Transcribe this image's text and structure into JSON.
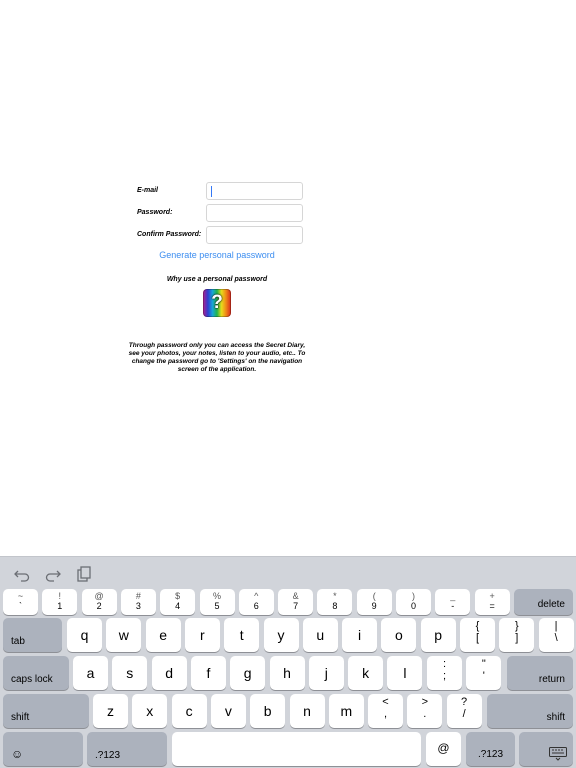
{
  "form": {
    "email_label": "E-mail",
    "password_label": "Password:",
    "confirm_label": "Confirm Password:",
    "email_value": "",
    "password_value": "",
    "confirm_value": "",
    "generate_link": "Generate personal password",
    "why_label": "Why use a personal password",
    "help_icon_glyph": "?",
    "description": "Through password only you can access the Secret Diary, see your photos, your notes, listen to your audio, etc.. To change the password go to 'Settings' on the navigation screen of the application."
  },
  "keyboard": {
    "toolbar": [
      "undo-icon",
      "redo-icon",
      "paste-icon"
    ],
    "row1": [
      {
        "top": "~",
        "bot": "`"
      },
      {
        "top": "!",
        "bot": "1"
      },
      {
        "top": "@",
        "bot": "2"
      },
      {
        "top": "#",
        "bot": "3"
      },
      {
        "top": "$",
        "bot": "4"
      },
      {
        "top": "%",
        "bot": "5"
      },
      {
        "top": "^",
        "bot": "6"
      },
      {
        "top": "&",
        "bot": "7"
      },
      {
        "top": "*",
        "bot": "8"
      },
      {
        "top": "(",
        "bot": "9"
      },
      {
        "top": ")",
        "bot": "0"
      },
      {
        "top": "_",
        "bot": "-"
      },
      {
        "top": "+",
        "bot": "="
      }
    ],
    "delete": "delete",
    "tab": "tab",
    "row2": [
      "q",
      "w",
      "e",
      "r",
      "t",
      "y",
      "u",
      "i",
      "o",
      "p"
    ],
    "row2_extra": [
      {
        "top": "{",
        "bot": "["
      },
      {
        "top": "}",
        "bot": "]"
      },
      {
        "top": "|",
        "bot": "\\"
      }
    ],
    "caps_lock": "caps lock",
    "row3": [
      "a",
      "s",
      "d",
      "f",
      "g",
      "h",
      "j",
      "k",
      "l"
    ],
    "row3_extra": [
      {
        "top": ":",
        "bot": ";"
      },
      {
        "top": "\"",
        "bot": "'"
      }
    ],
    "return": "return",
    "shift": "shift",
    "row4": [
      "z",
      "x",
      "c",
      "v",
      "b",
      "n",
      "m"
    ],
    "row4_extra": [
      {
        "top": "<",
        "bot": ","
      },
      {
        "top": ">",
        "bot": "."
      },
      {
        "top": "?",
        "bot": "/"
      }
    ],
    "emoji_glyph": "☺",
    "numbers": ".?123",
    "at": "@",
    "dismiss_icon": "keyboard-dismiss-icon"
  }
}
